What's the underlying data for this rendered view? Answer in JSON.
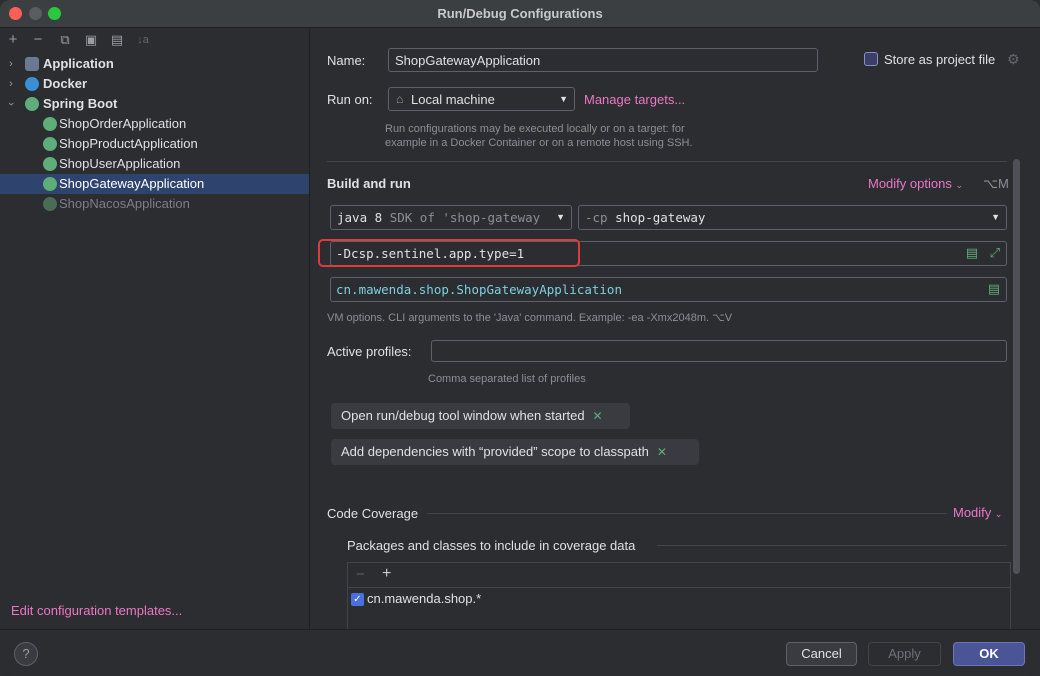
{
  "window": {
    "title": "Run/Debug Configurations"
  },
  "toolbar": {
    "add": "+",
    "remove": "−",
    "copy": "⧉",
    "save": "▣",
    "folder": "▤",
    "sort": "↓a"
  },
  "tree": {
    "groups": [
      {
        "label": "Application",
        "expanded": false
      },
      {
        "label": "Docker",
        "expanded": false
      },
      {
        "label": "Spring Boot",
        "expanded": true
      }
    ],
    "items": [
      {
        "label": "ShopOrderApplication"
      },
      {
        "label": "ShopProductApplication"
      },
      {
        "label": "ShopUserApplication"
      },
      {
        "label": "ShopGatewayApplication",
        "selected": true
      },
      {
        "label": "ShopNacosApplication",
        "dimmed": true
      }
    ],
    "edit_templates": "Edit configuration templates..."
  },
  "form": {
    "name_label": "Name:",
    "name_value": "ShopGatewayApplication",
    "store_label": "Store as project file",
    "runon_label": "Run on:",
    "runon_value": "Local machine",
    "manage_targets": "Manage targets...",
    "runon_hint_1": "Run configurations may be executed locally or on a target: for",
    "runon_hint_2": "example in a Docker Container or on a remote host using SSH.",
    "build_title": "Build and run",
    "modify_options": "Modify options",
    "modify_shortcut": "⌥M",
    "sdk_value": "java 8",
    "sdk_hint": "SDK of 'shop-gateway",
    "cp_prefix": "-cp",
    "cp_value": "shop-gateway",
    "vm_options": "-Dcsp.sentinel.app.type=1",
    "main_class": "cn.mawenda.shop.ShopGatewayApplication",
    "vm_hint": "VM options. CLI arguments to the 'Java' command. Example: -ea -Xmx2048m. ⌥V",
    "profiles_label": "Active profiles:",
    "profiles_value": "",
    "profiles_hint": "Comma separated list of profiles",
    "option_pills": [
      "Open run/debug tool window when started",
      "Add dependencies with “provided” scope to classpath"
    ],
    "coverage_title": "Code Coverage",
    "coverage_modify": "Modify",
    "packages_title": "Packages and classes to include in coverage data",
    "package_entry": "cn.mawenda.shop.*",
    "package_checked": true
  },
  "footer": {
    "help": "?",
    "cancel": "Cancel",
    "apply": "Apply",
    "ok": "OK"
  },
  "colors": {
    "accent_link": "#ed76c6",
    "selection": "#2e436e",
    "ok_button": "#4a5597",
    "highlight_red": "#e0393e",
    "spring_green": "#5fae7a"
  }
}
